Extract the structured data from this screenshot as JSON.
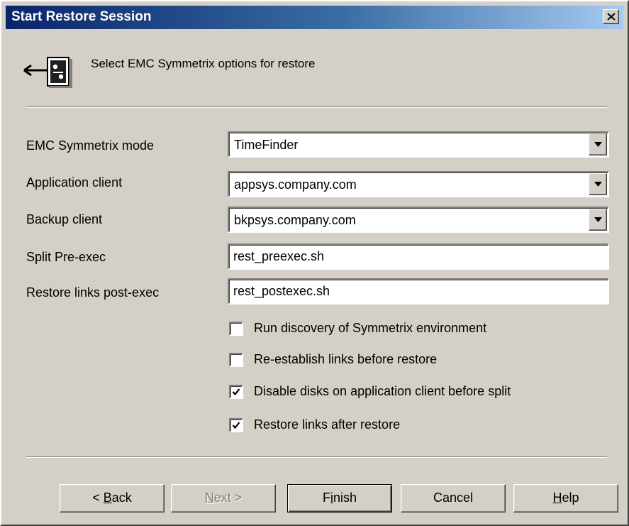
{
  "window": {
    "title": "Start Restore Session",
    "close_icon": "close-icon"
  },
  "header": {
    "icon": "restore-tape-icon",
    "text": "Select EMC Symmetrix options for restore"
  },
  "fields": {
    "mode": {
      "label": "EMC Symmetrix mode",
      "value": "TimeFinder"
    },
    "app_client": {
      "label": "Application client",
      "value": "appsys.company.com"
    },
    "backup_client": {
      "label": "Backup client",
      "value": "bkpsys.company.com"
    },
    "split_preexec": {
      "label": "Split Pre-exec",
      "value": "rest_preexec.sh"
    },
    "restore_postexec": {
      "label": "Restore links post-exec",
      "value": "rest_postexec.sh"
    }
  },
  "options": [
    {
      "label": "Run discovery of Symmetrix environment",
      "checked": false
    },
    {
      "label": "Re-establish links before restore",
      "checked": false
    },
    {
      "label": "Disable disks on application client before split",
      "checked": true
    },
    {
      "label": "Restore links after restore",
      "checked": true
    }
  ],
  "buttons": {
    "back": {
      "pre": "< ",
      "mnemonic": "B",
      "post": "ack",
      "enabled": true
    },
    "next": {
      "pre": "",
      "mnemonic": "N",
      "post": "ext >",
      "enabled": false
    },
    "finish": {
      "pre": "F",
      "mnemonic": "i",
      "post": "nish",
      "enabled": true
    },
    "cancel": {
      "label": "Cancel",
      "enabled": true
    },
    "help": {
      "pre": "",
      "mnemonic": "H",
      "post": "elp",
      "enabled": true
    }
  }
}
